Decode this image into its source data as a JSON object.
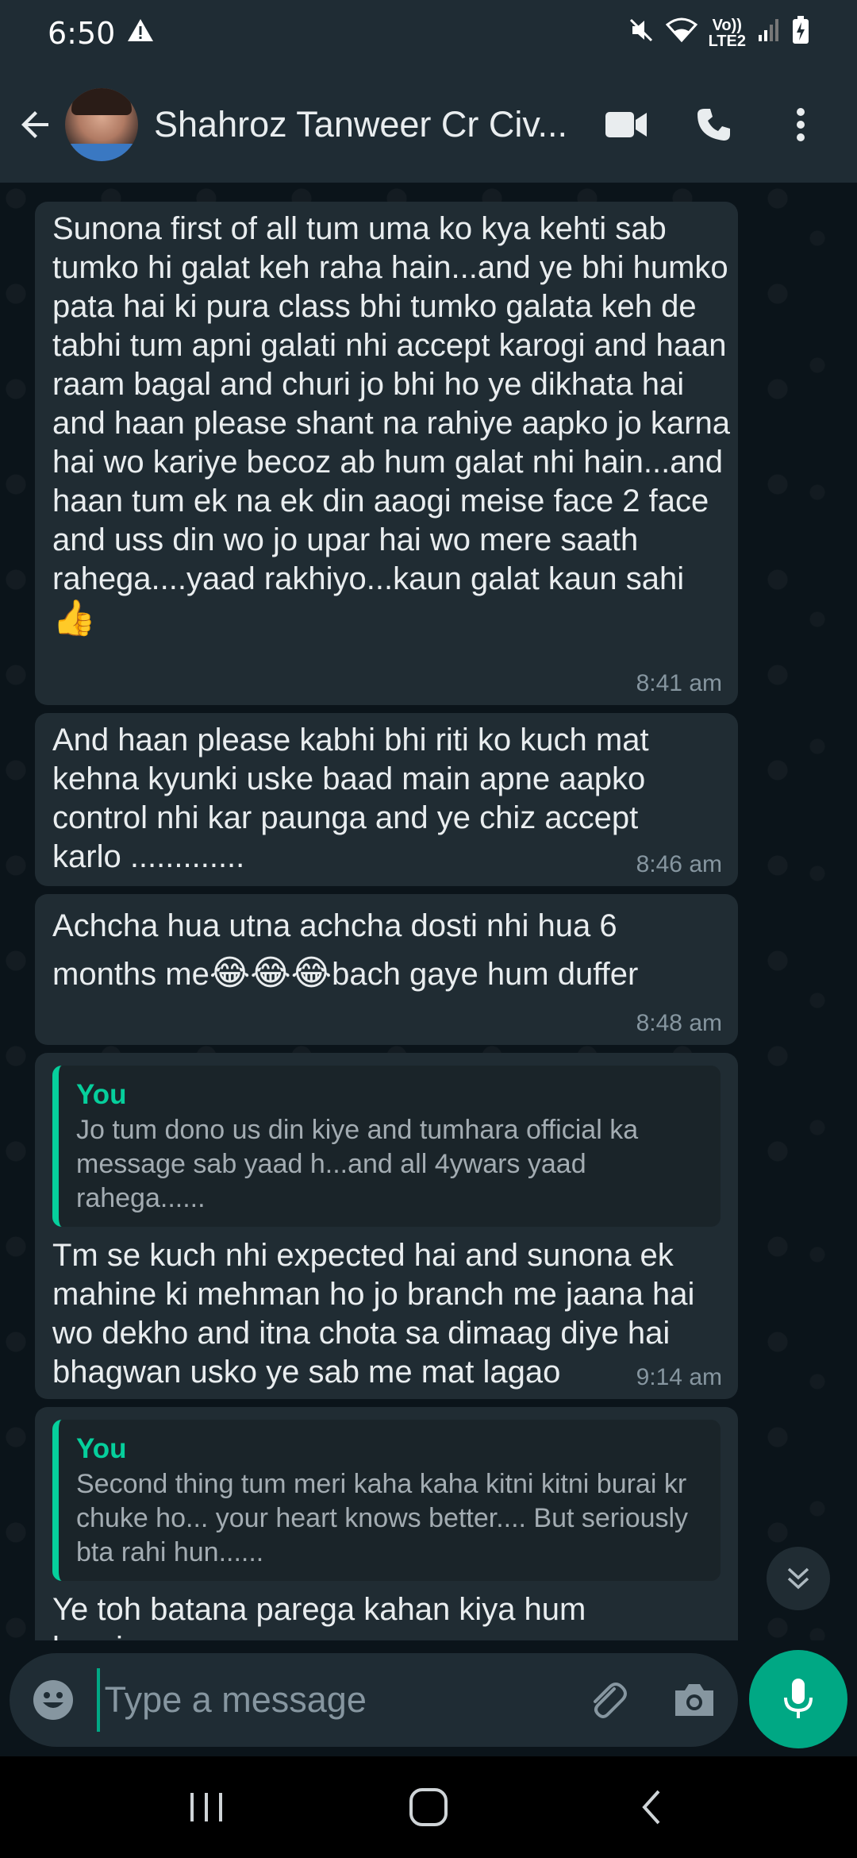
{
  "status_bar": {
    "time": "6:50",
    "warning_icon": "warning-icon",
    "network_label_top": "Vo))",
    "network_label_bottom": "LTE2"
  },
  "header": {
    "contact_name": "Shahroz Tanweer Cr Civ...",
    "icons": [
      "back-arrow-icon",
      "video-call-icon",
      "phone-icon",
      "more-vert-icon"
    ]
  },
  "messages": [
    {
      "text": "Sunona first of all tum uma ko kya kehti sab tumko hi galat keh raha hain...and ye bhi humko pata hai ki pura class bhi tumko galata keh de tabhi tum apni galati nhi accept karogi and haan raam bagal and churi jo bhi ho ye dikhata hai and haan please shant na rahiye aapko jo karna hai wo kariye becoz ab hum galat nhi hain...and haan tum ek na ek din aaogi meise face 2 face and uss din wo jo upar hai wo mere saath rahega....yaad rakhiyo...kaun galat kaun sahi",
      "emoji": "👍",
      "time": "8:41 am"
    },
    {
      "text": "And haan please kabhi bhi riti ko kuch mat kehna kyunki uske baad main apne aapko control nhi kar paunga and ye chiz accept karlo .............",
      "time": "8:46 am"
    },
    {
      "text_before": "Achcha hua utna achcha dosti nhi hua 6 months me",
      "emoji": "😂😂😂",
      "text_after": "bach gaye hum duffer",
      "time": "8:48 am"
    },
    {
      "quote_author": "You",
      "quote_text": "Jo tum dono us din kiye and tumhara official ka message sab yaad h...and all 4ywars yaad rahega......",
      "text": "Tm se kuch nhi expected hai and sunona ek mahine ki mehman ho jo branch me jaana hai wo dekho and itna chota sa dimaag diye hai bhagwan usko ye sab me mat lagao",
      "time": "9:14 am"
    },
    {
      "quote_author": "You",
      "quote_text": "Second thing tum meri kaha kaha kitni kitni burai kr chuke ho... your heart knows better.... But seriously bta rahi hun......",
      "text": "Ye toh batana parega kahan kiya hum burai"
    }
  ],
  "composer": {
    "placeholder": "Type a message",
    "value": ""
  },
  "colors": {
    "accent": "#00a884",
    "quote_bar": "#06cf9c",
    "bubble": "#202c33",
    "header": "#1f2c34",
    "background": "#0b141a"
  }
}
